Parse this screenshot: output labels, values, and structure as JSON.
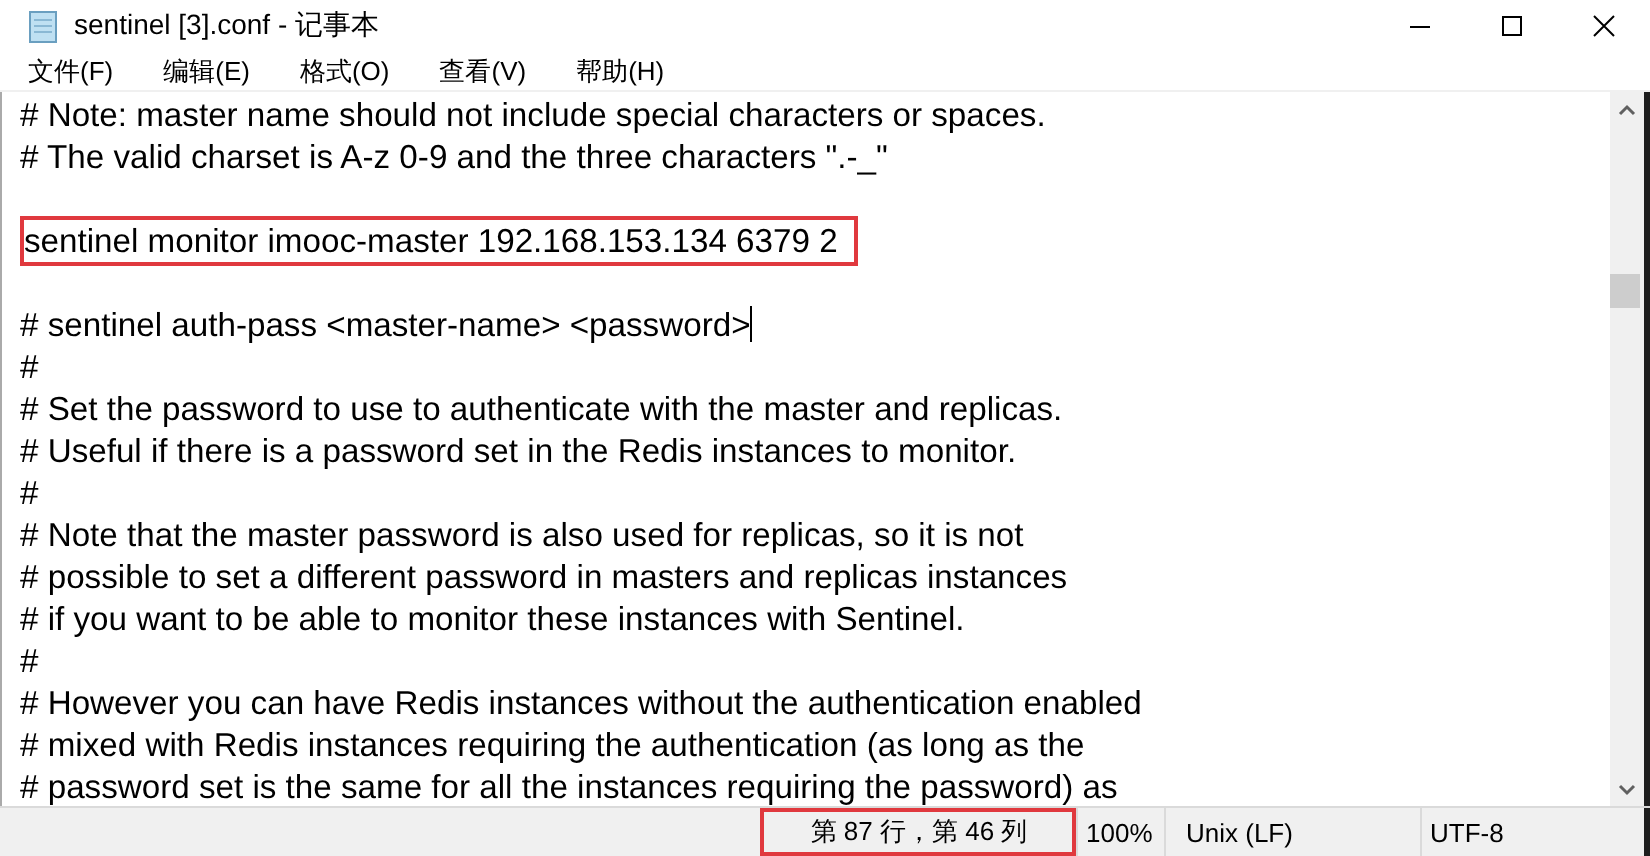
{
  "window": {
    "title": "sentinel [3].conf - 记事本"
  },
  "menu": [
    "文件(F)",
    "编辑(E)",
    "格式(O)",
    "查看(V)",
    "帮助(H)"
  ],
  "editor": {
    "lines": [
      {
        "kind": "text",
        "text": "# Note: master name should not include special characters or spaces.",
        "highlighted": false,
        "caret": false
      },
      {
        "kind": "text",
        "text": "# The valid charset is A-z 0-9 and the three characters \".-_\"",
        "highlighted": false,
        "caret": false
      },
      {
        "kind": "blank"
      },
      {
        "kind": "text",
        "text": "sentinel monitor imooc-master 192.168.153.134 6379 2",
        "highlighted": true,
        "caret": false
      },
      {
        "kind": "blank"
      },
      {
        "kind": "text",
        "text": "# sentinel auth-pass <master-name> <password>",
        "highlighted": false,
        "caret": true
      },
      {
        "kind": "text",
        "text": "#",
        "highlighted": false,
        "caret": false
      },
      {
        "kind": "text",
        "text": "# Set the password to use to authenticate with the master and replicas.",
        "highlighted": false,
        "caret": false
      },
      {
        "kind": "text",
        "text": "# Useful if there is a password set in the Redis instances to monitor.",
        "highlighted": false,
        "caret": false
      },
      {
        "kind": "text",
        "text": "#",
        "highlighted": false,
        "caret": false
      },
      {
        "kind": "text",
        "text": "# Note that the master password is also used for replicas, so it is not",
        "highlighted": false,
        "caret": false
      },
      {
        "kind": "text",
        "text": "# possible to set a different password in masters and replicas instances",
        "highlighted": false,
        "caret": false
      },
      {
        "kind": "text",
        "text": "# if you want to be able to monitor these instances with Sentinel.",
        "highlighted": false,
        "caret": false
      },
      {
        "kind": "text",
        "text": "#",
        "highlighted": false,
        "caret": false
      },
      {
        "kind": "text",
        "text": "# However you can have Redis instances without the authentication enabled",
        "highlighted": false,
        "caret": false
      },
      {
        "kind": "text",
        "text": "# mixed with Redis instances requiring the authentication (as long as the",
        "highlighted": false,
        "caret": false
      },
      {
        "kind": "text",
        "text": "# password set is the same for all the instances requiring the password) as",
        "highlighted": false,
        "caret": false
      }
    ]
  },
  "status_bar": {
    "position": "第 87 行，第 46 列",
    "position_highlighted": true,
    "zoom": "100%",
    "line_ending": "Unix (LF)",
    "encoding": "UTF-8"
  }
}
